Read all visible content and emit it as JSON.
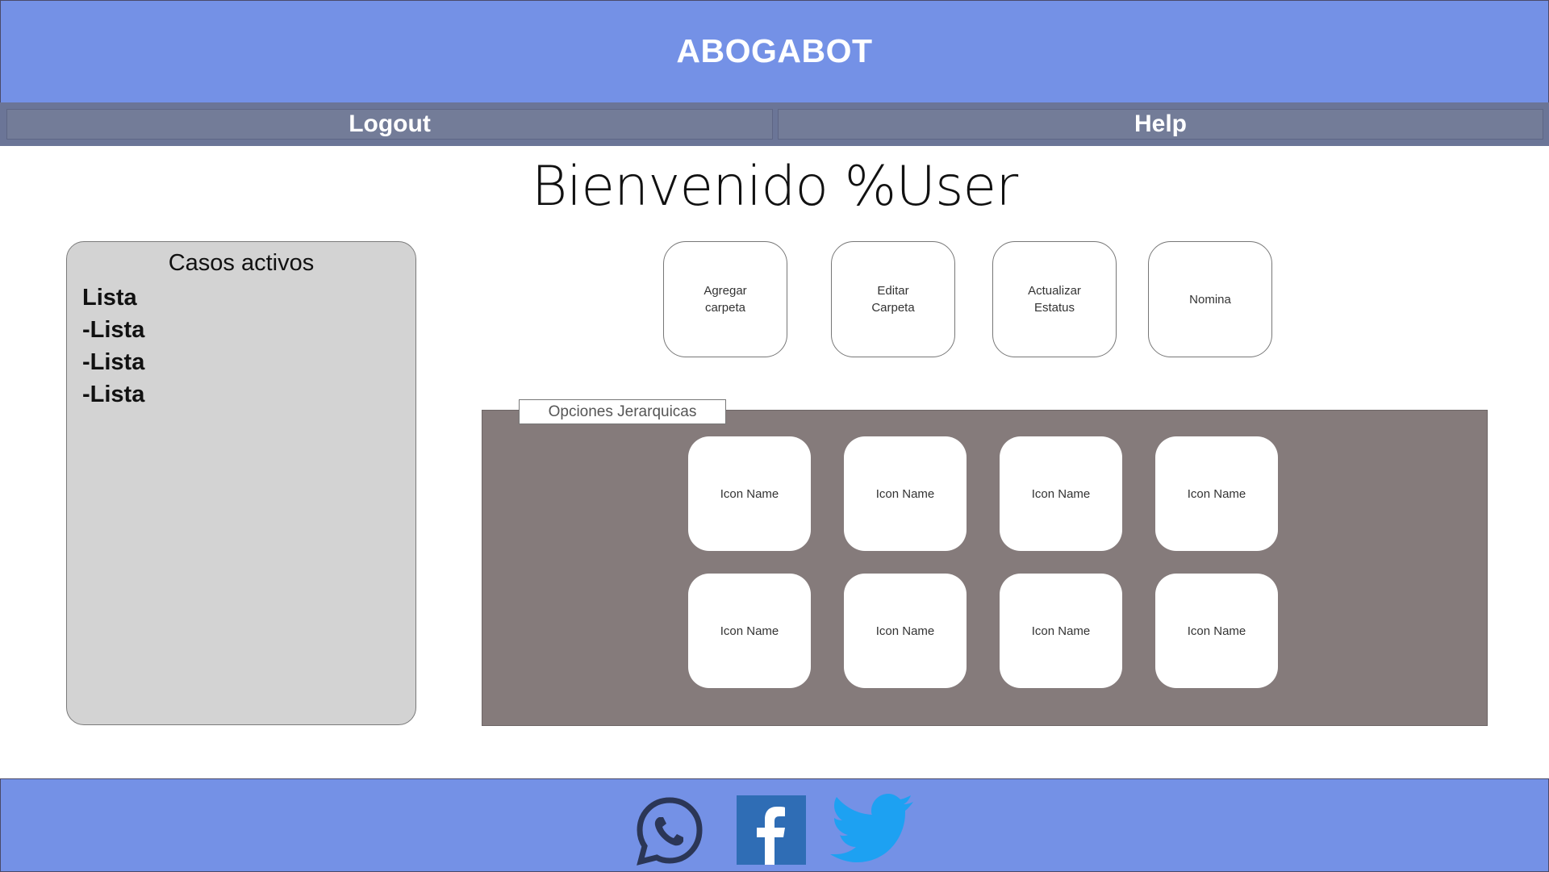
{
  "header": {
    "title": "ABOGABOT"
  },
  "nav": {
    "logout_label": "Logout",
    "help_label": "Help"
  },
  "welcome": {
    "text": "Bienvenido %User"
  },
  "cases": {
    "title": "Casos activos",
    "items": [
      "Lista",
      "-Lista",
      "-Lista",
      "-Lista"
    ]
  },
  "actions": [
    {
      "label": "Agregar\ncarpeta"
    },
    {
      "label": "Editar\nCarpeta"
    },
    {
      "label": "Actualizar\nEstatus"
    },
    {
      "label": "Nomina"
    }
  ],
  "hierarchy": {
    "tab_label": "Opciones Jerarquicas",
    "icons": [
      "Icon Name",
      "Icon Name",
      "Icon Name",
      "Icon Name",
      "Icon Name",
      "Icon Name",
      "Icon Name",
      "Icon Name"
    ]
  },
  "footer": {
    "social": [
      "whatsapp-icon",
      "facebook-icon",
      "twitter-icon"
    ]
  },
  "colors": {
    "header_bg": "#7491e6",
    "nav_bg": "#6b7597",
    "panel_bg": "#d3d3d3",
    "hier_bg": "#857b7b",
    "facebook": "#2f6db5",
    "twitter": "#1da1f2",
    "whatsapp": "#2b3656"
  }
}
